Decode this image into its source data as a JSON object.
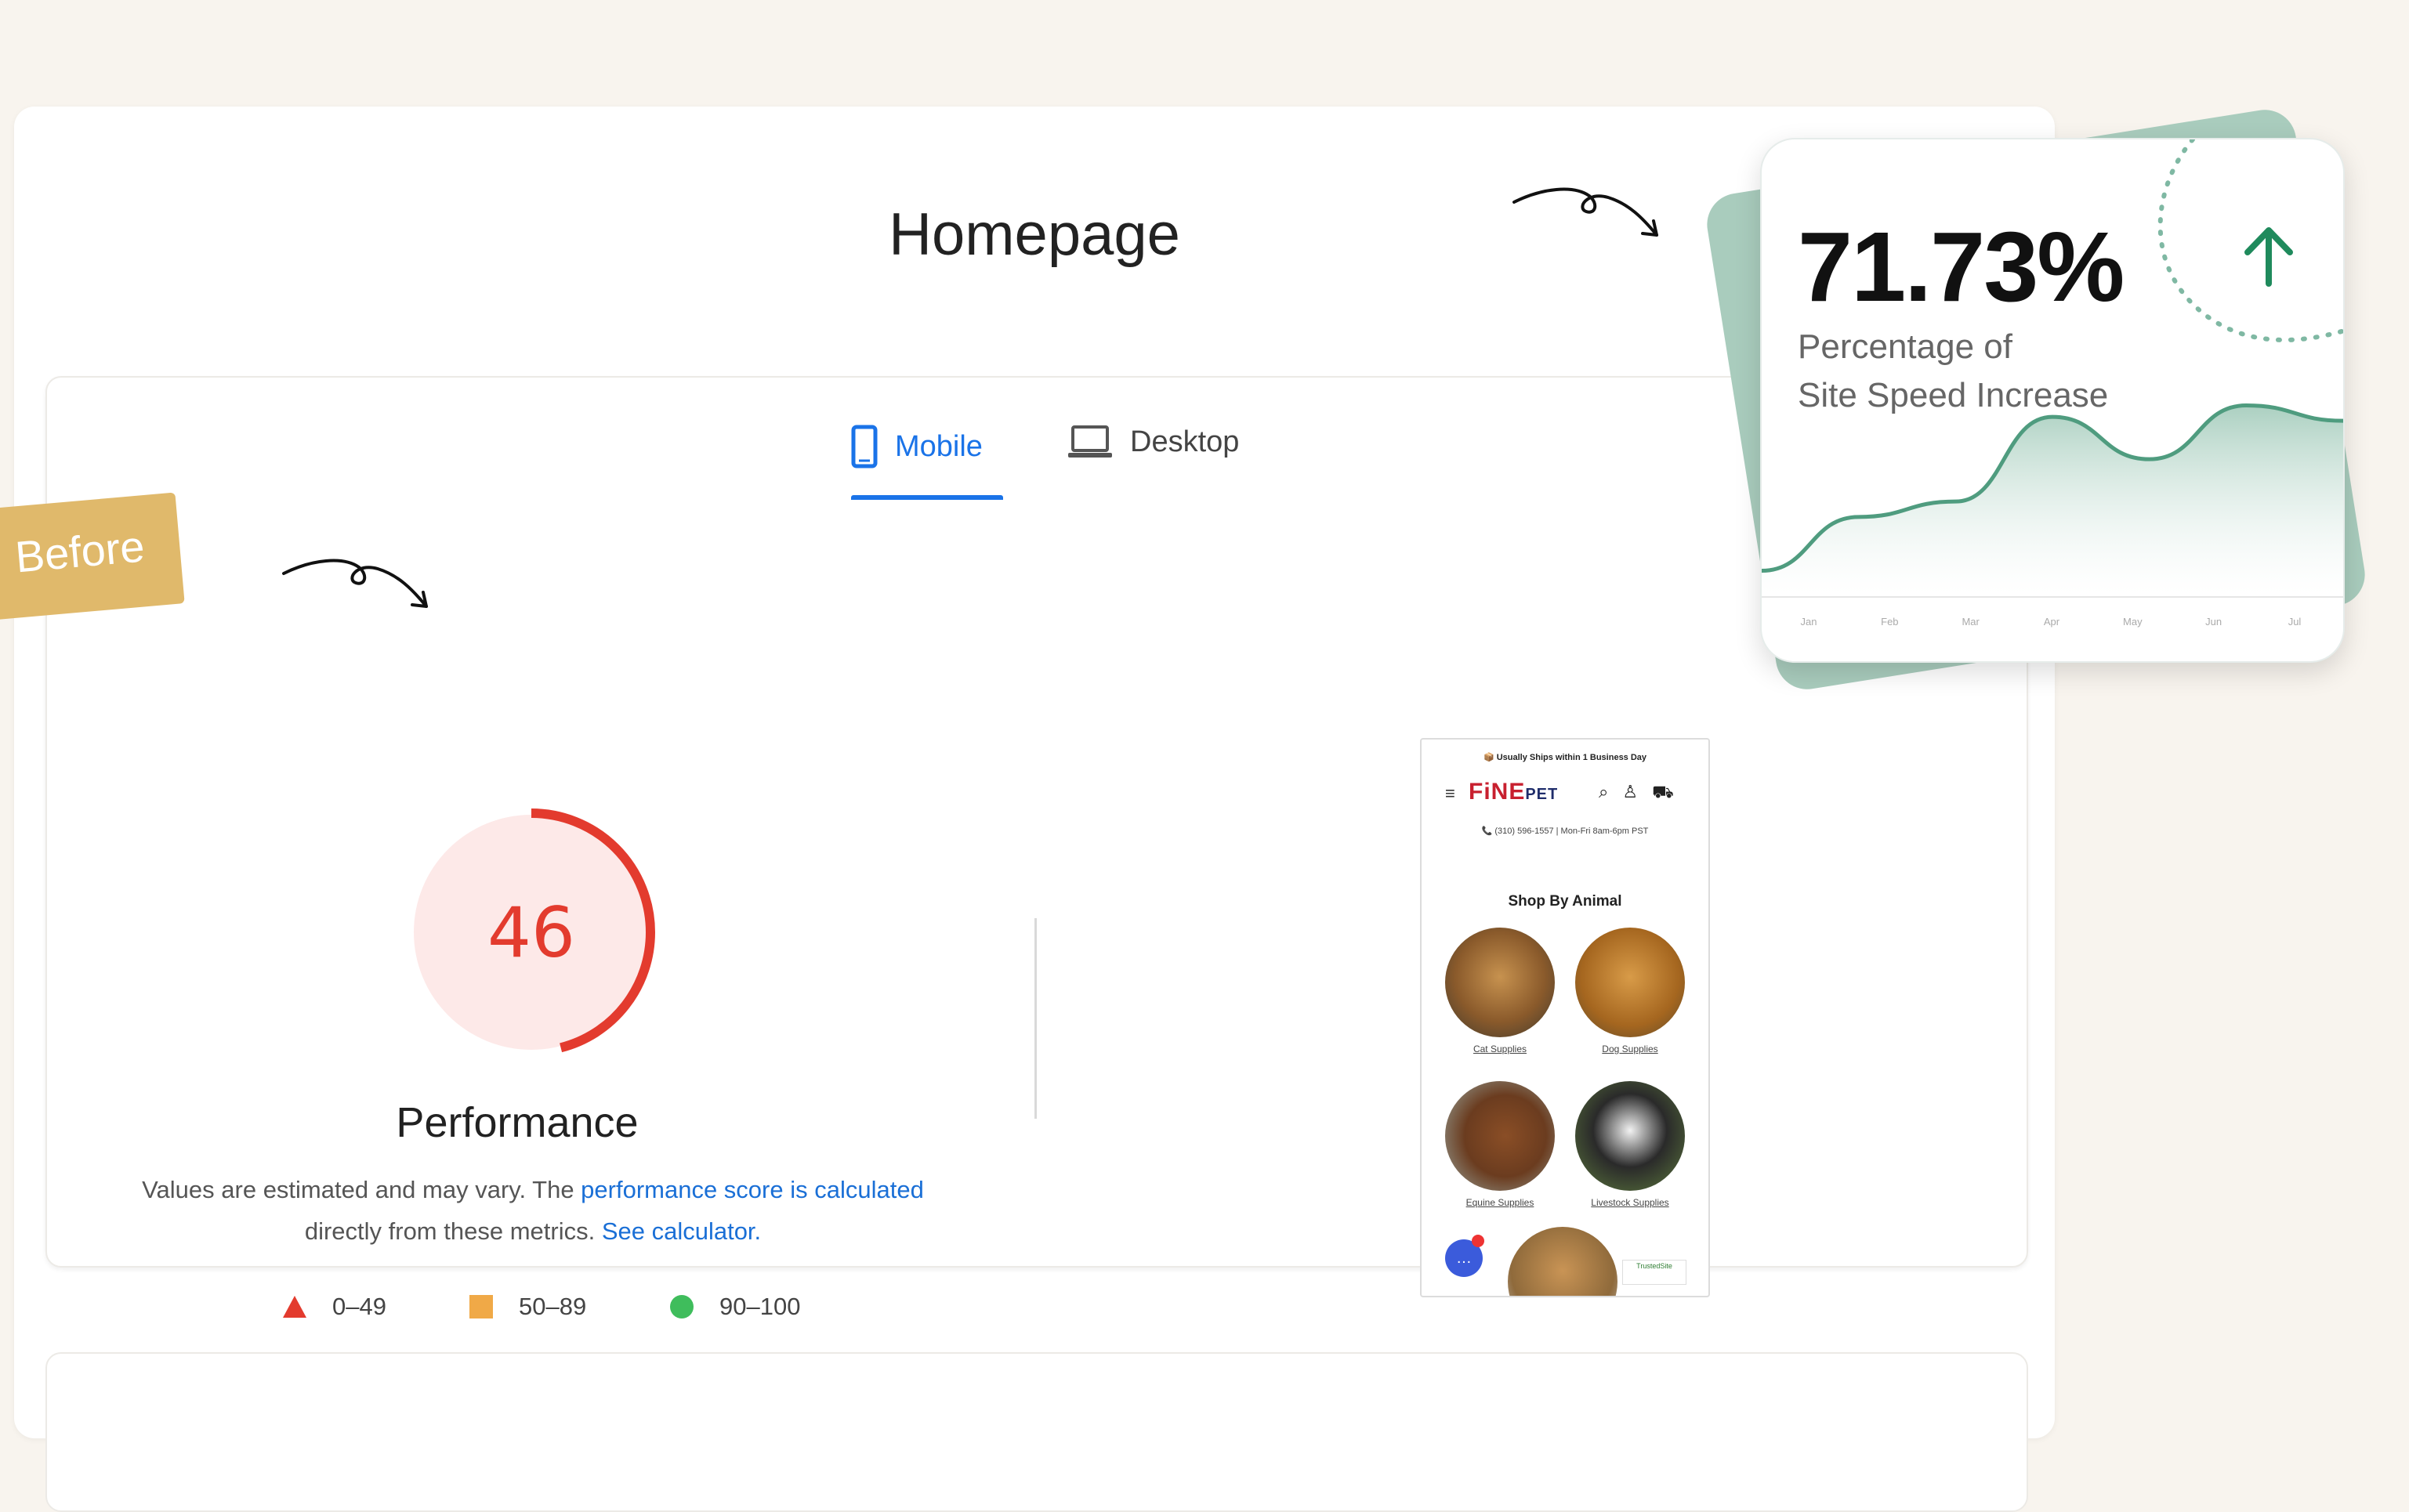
{
  "page": {
    "title": "Homepage"
  },
  "tabs": [
    {
      "label": "Mobile",
      "icon": "smartphone-icon",
      "active": true
    },
    {
      "label": "Desktop",
      "icon": "laptop-icon",
      "active": false
    }
  ],
  "badge": {
    "label": "Before"
  },
  "performance": {
    "score": "46",
    "label": "Performance",
    "desc_part1": "Values are estimated and may vary. The ",
    "desc_link1": "performance score is calculated",
    "desc_part2": "directly from these metrics. ",
    "desc_link2": "See calculator.",
    "score_color": "#e33b2e"
  },
  "legend": [
    {
      "range": "0–49",
      "shape": "triangle",
      "color": "#e33b2e"
    },
    {
      "range": "50–89",
      "shape": "square",
      "color": "#f0a947"
    },
    {
      "range": "90–100",
      "shape": "circle",
      "color": "#3fbd5c"
    }
  ],
  "preview": {
    "topbar": "📦 Usually Ships within 1 Business Day",
    "logo_main": "FiNE",
    "logo_sub": "PET",
    "phone_line": "📞 (310) 596-1557 | Mon-Fri 8am-6pm PST",
    "heading": "Shop By Animal",
    "animals": [
      "Cat Supplies",
      "Dog Supplies",
      "Equine Supplies",
      "Livestock Supplies"
    ],
    "trusted": "TrustedSite"
  },
  "stats": {
    "value": "71.73%",
    "label_line1": "Percentage of",
    "label_line2": "Site Speed Increase",
    "accent": "#1f8a5c"
  },
  "chart_data": {
    "type": "area",
    "categories": [
      "Jan",
      "Feb",
      "Mar",
      "Apr",
      "May",
      "Jun",
      "Jul"
    ],
    "values": [
      12,
      40,
      48,
      92,
      70,
      98,
      90
    ],
    "title": "",
    "xlabel": "",
    "ylabel": "",
    "ylim": [
      0,
      110
    ]
  }
}
